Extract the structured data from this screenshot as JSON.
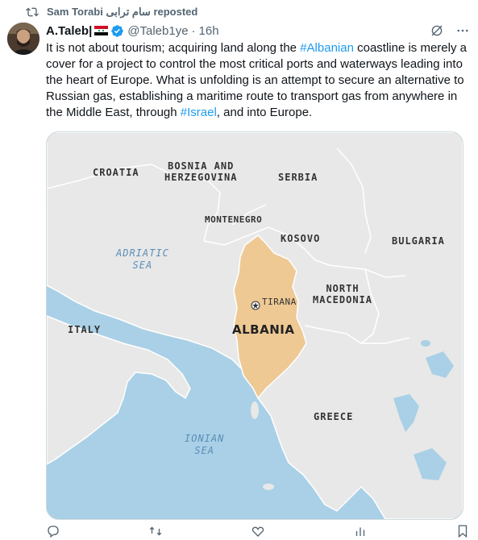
{
  "repost": {
    "icon": "repost-icon",
    "label": "Sam Torabi سام ترابی reposted"
  },
  "author": {
    "name": "A.Taleb|",
    "flag": "syria-flag",
    "verified": "verified-badge-icon",
    "handle": "@Taleb1ye",
    "separator": "·",
    "time": "16h"
  },
  "tweet": {
    "text_1": "It is not about tourism; acquiring land along the ",
    "hashtag_1": "#Albanian",
    "text_2": " coastline is merely a cover for a project to control the most critical ports and waterways leading into the heart of Europe. What is unfolding is an attempt to secure an alternative to Russian gas, establishing a maritime route to transport gas from anywhere in the Middle East, through ",
    "hashtag_2": "#Israel",
    "text_3": ", and into Europe."
  },
  "map": {
    "labels": {
      "croatia": "CROATIA",
      "bosnia_1": "BOSNIA AND",
      "bosnia_2": "HERZEGOVINA",
      "serbia": "SERBIA",
      "montenegro": "MONTENEGRO",
      "kosovo": "KOSOVO",
      "bulgaria": "BULGARIA",
      "adriatic_1": "ADRIATIC",
      "adriatic_2": "SEA",
      "north_1": "NORTH",
      "north_2": "MACEDONIA",
      "tirana": "TIRANA",
      "italy": "ITALY",
      "albania": "ALBANIA",
      "greece": "GREECE",
      "ionian_1": "IONIAN",
      "ionian_2": "SEA"
    },
    "colors": {
      "sea": "#a9d0e6",
      "land": "#e8e8e8",
      "albania": "#eec994",
      "sea_text": "#5b8db8",
      "land_text": "#333333"
    }
  },
  "colors": {
    "accent": "#1d9bf0",
    "muted": "#536471",
    "text": "#0f1419"
  }
}
